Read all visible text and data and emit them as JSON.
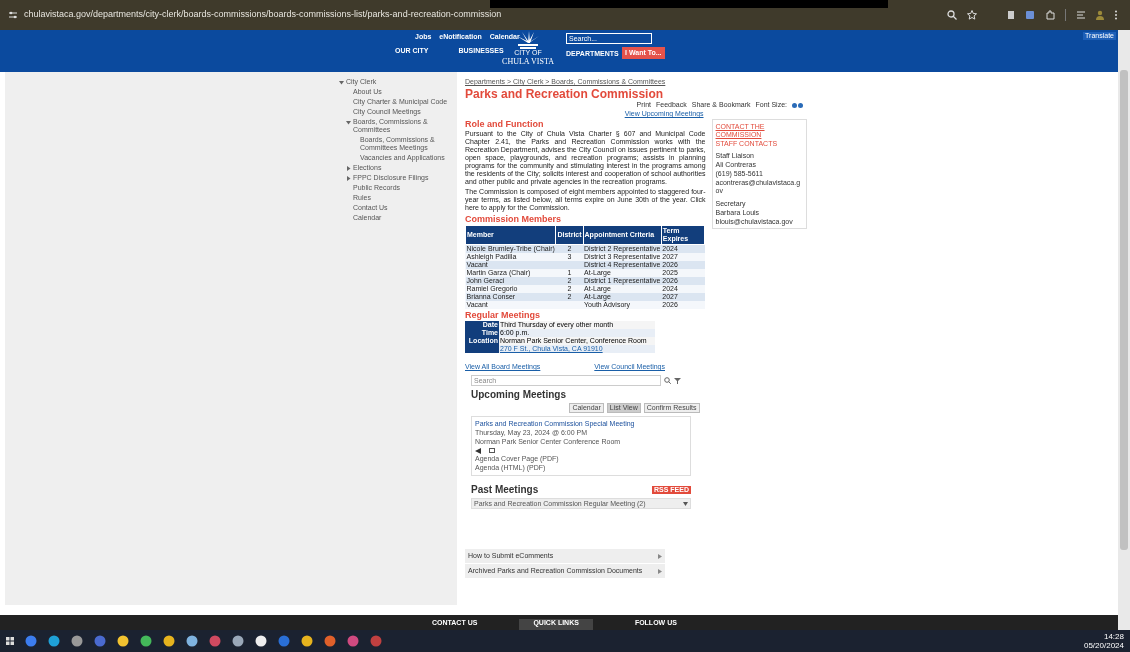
{
  "browser": {
    "url": "chulavistaca.gov/departments/city-clerk/boards-commissions/boards-commissions-list/parks-and-recreation-commission"
  },
  "header": {
    "top_links": [
      "Jobs",
      "eNotification",
      "Calendar"
    ],
    "nav_left": [
      "OUR CITY",
      "BUSINESSES"
    ],
    "logo_small": "CITY OF",
    "logo_name": "CHULA VISTA",
    "search": {
      "placeholder": "Search..."
    },
    "nav_right": "DEPARTMENTS",
    "cta": "I Want To...",
    "translate": "Translate"
  },
  "sidebar": {
    "items": [
      {
        "label": "City Clerk",
        "expanded": true,
        "children": [
          {
            "label": "About Us"
          },
          {
            "label": "City Charter & Municipal Code"
          },
          {
            "label": "City Council Meetings"
          },
          {
            "label": "Boards, Commissions & Committees",
            "expanded": true,
            "children": [
              {
                "label": "Boards, Commissions & Committees Meetings"
              },
              {
                "label": "Vacancies and Applications"
              }
            ]
          },
          {
            "label": "Elections",
            "expanded": false
          },
          {
            "label": "FPPC Disclosure Filings",
            "expanded": false
          },
          {
            "label": "Public Records"
          },
          {
            "label": "Rules"
          },
          {
            "label": "Contact Us"
          },
          {
            "label": "Calendar"
          }
        ]
      }
    ]
  },
  "breadcrumb": "Departments > City Clerk > Boards, Commissions & Committees",
  "title": "Parks and Recreation Commission",
  "tools": [
    "Print",
    "Feedback",
    "Share & Bookmark",
    "Font Size:"
  ],
  "view_upcoming": "View Upcoming Meetings",
  "role_heading": "Role and Function",
  "role_text": "Pursuant to the City of Chula Vista Charter § 607 and Municipal Code Chapter 2.41, the Parks and Recreation Commission works with the Recreation Department, advises the City Council on issues pertinent to parks, open space, playgrounds, and recreation programs; assists in planning programs for the community and stimulating interest in the programs among the residents of the City; solicits interest and cooperation of school authorities and other public and private agencies in the recreation programs.",
  "composition_text": "The Commission is composed of eight members appointed to staggered four-year terms, as listed below, all terms expire on June 30th of the year. Click here to apply for the Commission.",
  "contact_card": {
    "title": "CONTACT THE COMMISSION",
    "subtitle": "STAFF CONTACTS",
    "lines": [
      "Staff Liaison",
      "Ali Contreras",
      "(619) 585-5611",
      "acontreras@chulavistaca.gov",
      "Secretary",
      "Barbara Louis",
      "blouis@chulavistaca.gov"
    ]
  },
  "members_heading": "Commission Members",
  "members_table": {
    "columns": [
      "Member",
      "District",
      "Appointment Criteria",
      "Term Expires"
    ],
    "rows": [
      [
        "Nicole Brumley-Tribe (Chair)",
        "2",
        "District 2 Representative",
        "2024"
      ],
      [
        "Ashleigh Padilla",
        "3",
        "District 3 Representative",
        "2027"
      ],
      [
        "Vacant",
        "",
        "District 4 Representative",
        "2026"
      ],
      [
        "Martin Garza (Chair)",
        "1",
        "At-Large",
        "2025"
      ],
      [
        "John Geraci",
        "2",
        "District 1 Representative",
        "2026"
      ],
      [
        "Ramiel Gregorio",
        "2",
        "At-Large",
        "2024"
      ],
      [
        "Brianna Conser",
        "2",
        "At-Large",
        "2027"
      ],
      [
        "Vacant",
        "",
        "Youth Advisory",
        "2026"
      ]
    ]
  },
  "meetings_heading": "Regular Meetings",
  "meetings_table": [
    {
      "label": "Date",
      "value": "Third Thursday of every other month"
    },
    {
      "label": "Time",
      "value": "6:00 p.m."
    },
    {
      "label": "Location",
      "value": "Norman Park Senior Center, Conference Room"
    },
    {
      "value": "270 F St., Chula Vista, CA 91910",
      "link": true
    }
  ],
  "links": [
    "View All Board Meetings",
    "View Council Meetings"
  ],
  "meeting_search": {
    "placeholder": "Search"
  },
  "upcoming_heading": "Upcoming Meetings",
  "upcoming_buttons": [
    "Calendar",
    "List View",
    "Confirm Results"
  ],
  "meeting_card": {
    "title": "Parks and Recreation Commission Special Meeting",
    "lines": [
      "Thursday, May 23, 2024 @ 6:00 PM",
      "Norman Park Senior Center Conference Room"
    ],
    "docs": [
      "Agenda Cover Page  (PDF)",
      "Agenda  (HTML)  (PDF)"
    ]
  },
  "past_heading": "Past Meetings",
  "past_badge": "RSS FEED",
  "past_select": "Parks and Recreation Commission Regular Meeting (2)",
  "accordions": [
    "How to Submit eComments",
    "Archived Parks and Recreation Commission Documents"
  ],
  "footer": [
    "CONTACT US",
    "QUICK LINKS",
    "FOLLOW US"
  ],
  "taskbar": {
    "time": "14:28",
    "date": "05/20/2024"
  }
}
